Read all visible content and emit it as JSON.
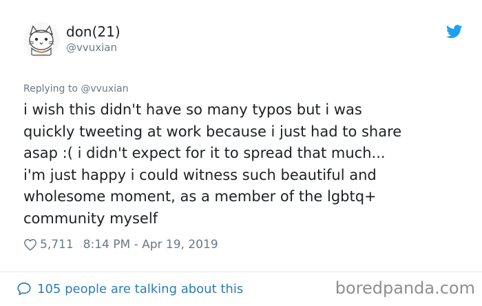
{
  "author": {
    "display_name": "don(21)",
    "handle": "@vvuxian",
    "avatar_icon": "cat-drawing-avatar"
  },
  "reply": {
    "prefix": "Replying to",
    "mention": "@vvuxian"
  },
  "tweet": {
    "lines": [
      "i wish this didn't have so many typos but i was",
      "quickly tweeting at work because i just had to share",
      "asap :( i didn't expect for it to spread that much...",
      "i'm just happy i could witness such beautiful and",
      "wholesome moment, as a member of the lgbtq+",
      "community myself"
    ],
    "likes": "5,711",
    "timestamp": "8:14 PM - Apr 19, 2019"
  },
  "footer": {
    "talking_text": "105 people are talking about this"
  },
  "watermark": "boredpanda.com",
  "colors": {
    "twitter_blue": "#1da1f2",
    "link_blue": "#2b7bb9",
    "meta_gray": "#697882",
    "text": "#1c2022"
  },
  "icons": [
    "twitter-bird-icon",
    "heart-icon",
    "speech-bubble-icon"
  ]
}
